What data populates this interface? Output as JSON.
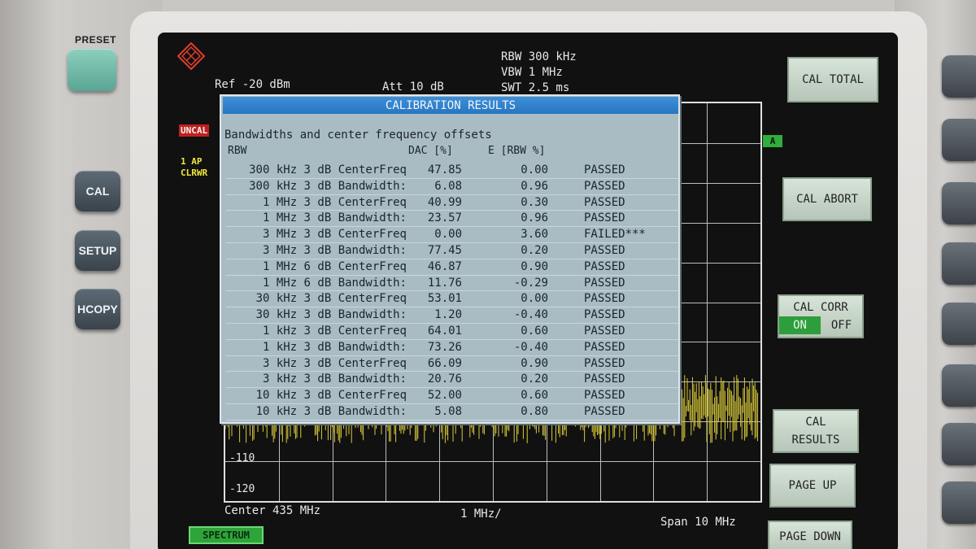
{
  "panel": {
    "preset_label": "PRESET",
    "cal_label": "CAL",
    "setup_label": "SETUP",
    "hcopy_label": "HCOPY"
  },
  "header": {
    "rbw": "RBW 300 kHz",
    "vbw": "VBW 1 MHz",
    "swt": "SWT 2.5 ms",
    "ref": "Ref -20 dBm",
    "att": "Att  10 dB"
  },
  "indicators": {
    "uncal": "UNCAL",
    "trace_mode_1": "1 AP",
    "trace_mode_2": "CLRWR",
    "a_tag": "A"
  },
  "axis": {
    "level_110": "-110",
    "level_120": "-120",
    "center": "Center 435 MHz",
    "per_div": "1 MHz/",
    "span": "Span 10 MHz"
  },
  "softkeys": {
    "cal_total": "CAL TOTAL",
    "cal_abort": "CAL ABORT",
    "cal_corr": "CAL CORR",
    "cal_corr_on": "ON",
    "cal_corr_off": "OFF",
    "cal_results_1": "CAL",
    "cal_results_2": "RESULTS",
    "page_up": "PAGE UP",
    "page_down": "PAGE DOWN"
  },
  "mode_tab": "SPECTRUM",
  "dialog": {
    "title": "CALIBRATION RESULTS",
    "subtitle": "Bandwidths and center frequency offsets",
    "col_rbw": "RBW",
    "col_dac": "DAC [%]",
    "col_e": "E [RBW %]",
    "rows": [
      {
        "rbw": "300 kHz 3 dB CenterFreq",
        "dac": "47.85",
        "e": "0.00",
        "status": "PASSED"
      },
      {
        "rbw": "300 kHz 3 dB Bandwidth:",
        "dac": "6.08",
        "e": "0.96",
        "status": "PASSED"
      },
      {
        "rbw": "1 MHz 3 dB CenterFreq",
        "dac": "40.99",
        "e": "0.30",
        "status": "PASSED"
      },
      {
        "rbw": "1 MHz 3 dB Bandwidth:",
        "dac": "23.57",
        "e": "0.96",
        "status": "PASSED"
      },
      {
        "rbw": "3 MHz 3 dB CenterFreq",
        "dac": "0.00",
        "e": "3.60",
        "status": "FAILED***"
      },
      {
        "rbw": "3 MHz 3 dB Bandwidth:",
        "dac": "77.45",
        "e": "0.20",
        "status": "PASSED"
      },
      {
        "rbw": "1 MHz 6 dB CenterFreq",
        "dac": "46.87",
        "e": "0.90",
        "status": "PASSED"
      },
      {
        "rbw": "1 MHz 6 dB Bandwidth:",
        "dac": "11.76",
        "e": "-0.29",
        "status": "PASSED"
      },
      {
        "rbw": "30 kHz 3 dB CenterFreq",
        "dac": "53.01",
        "e": "0.00",
        "status": "PASSED"
      },
      {
        "rbw": "30 kHz 3 dB Bandwidth:",
        "dac": "1.20",
        "e": "-0.40",
        "status": "PASSED"
      },
      {
        "rbw": "1 kHz 3 dB CenterFreq",
        "dac": "64.01",
        "e": "0.60",
        "status": "PASSED"
      },
      {
        "rbw": "1 kHz 3 dB Bandwidth:",
        "dac": "73.26",
        "e": "-0.40",
        "status": "PASSED"
      },
      {
        "rbw": "3 kHz 3 dB CenterFreq",
        "dac": "66.09",
        "e": "0.90",
        "status": "PASSED"
      },
      {
        "rbw": "3 kHz 3 dB Bandwidth:",
        "dac": "20.76",
        "e": "0.20",
        "status": "PASSED"
      },
      {
        "rbw": "10 kHz 3 dB CenterFreq",
        "dac": "52.00",
        "e": "0.60",
        "status": "PASSED"
      },
      {
        "rbw": "10 kHz 3 dB Bandwidth:",
        "dac": "5.08",
        "e": "0.80",
        "status": "PASSED"
      }
    ]
  },
  "colors": {
    "trace": "#d8c93a",
    "title_bar": "#2f80cc",
    "dialog_bg": "#a9bcc4",
    "mode_tab": "#2ea43a"
  }
}
